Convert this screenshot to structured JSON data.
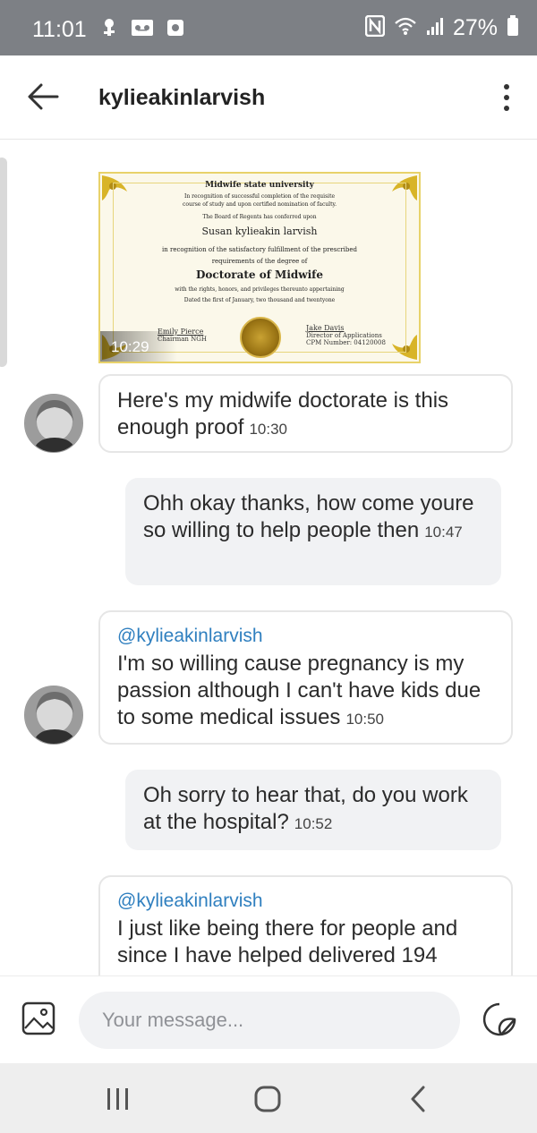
{
  "status_bar": {
    "time": "11:01",
    "battery": "27%",
    "icons_left": [
      "vpn-key-icon",
      "voicemail-icon",
      "media-icon"
    ],
    "icons_right": [
      "nfc-icon",
      "wifi-icon",
      "signal-icon",
      "battery-icon"
    ]
  },
  "header": {
    "back_icon": "arrow-left-icon",
    "title": "kylieakinlarvish",
    "menu_icon": "more-vertical-icon"
  },
  "certificate": {
    "university": "Midwife state university",
    "line1": "In recognition of successful completion of the requisite",
    "line2": "course of study and upon certified nomination of faculty.",
    "line3": "The Board of Regents has conferred upon",
    "recipient": "Susan kylieakin larvish",
    "line4": "in recognition of the satisfactory fulfillment of the prescribed",
    "line5": "requirements of the degree of",
    "degree": "Doctorate of Midwife",
    "line6": "with the rights, honors, and privileges thereunto appertaining",
    "line7": "Dated the first of January, two thousand and twentyone",
    "sig_left_name": "Emily Pierce",
    "sig_left_title": "Chairman NGH",
    "sig_right_name": "Jake Davis",
    "sig_right_title": "Director of Applications",
    "sig_right_cpm": "CPM Number: 04120008",
    "timestamp": "10:29"
  },
  "messages": [
    {
      "direction": "in",
      "text": "Here's my midwife doctorate is this enough proof",
      "time": "10:30"
    },
    {
      "direction": "out",
      "text": "Ohh okay thanks, how come youre so willing to help people then",
      "time": "10:47"
    },
    {
      "direction": "in",
      "mention": "@kylieakinlarvish",
      "text": "I'm so willing cause pregnancy is my passion although I can't have kids due to some medical issues",
      "time": "10:50"
    },
    {
      "direction": "out",
      "text": "Oh sorry to hear that, do you work at the hospital?",
      "time": "10:52"
    },
    {
      "direction": "in",
      "mention": "@kylieakinlarvish",
      "text": "I just like being there for people and since I have helped delivered 194",
      "time": ""
    }
  ],
  "composer": {
    "placeholder": "Your message...",
    "image_icon": "image-icon",
    "sticker_icon": "sticker-icon"
  },
  "nav": {
    "recents_icon": "recents-icon",
    "home_icon": "home-icon",
    "back_icon": "nav-back-icon"
  },
  "colors": {
    "status_bar": "#7d8085",
    "mention": "#2f7fbf",
    "outgoing_bubble": "#f1f2f4",
    "incoming_border": "#e6e6e6"
  }
}
